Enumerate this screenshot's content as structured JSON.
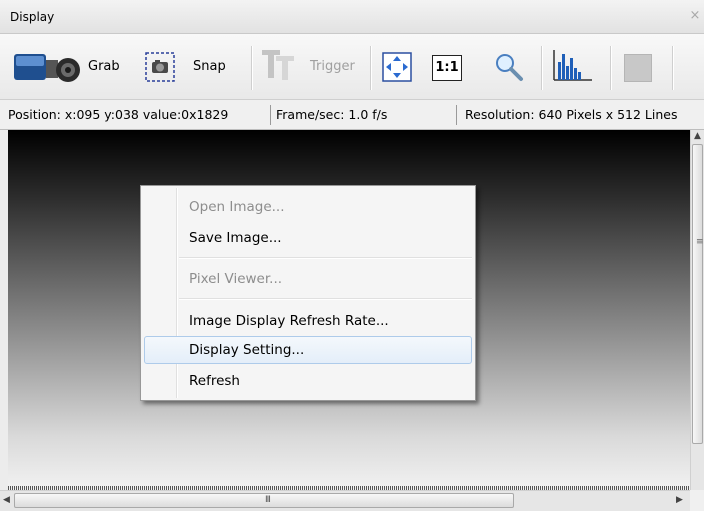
{
  "window": {
    "title": "Display",
    "close_glyph": "×"
  },
  "toolbar": {
    "grab_label": "Grab",
    "snap_label": "Snap",
    "trigger_label": "Trigger",
    "one_to_one_label": "1:1"
  },
  "status": {
    "position": "Position: x:095 y:038 value:0x1829",
    "frame_rate": "Frame/sec: 1.0 f/s",
    "resolution": "Resolution: 640 Pixels x 512 Lines"
  },
  "context_menu": {
    "items": [
      {
        "label": "Open Image...",
        "enabled": false
      },
      {
        "label": "Save Image...",
        "enabled": true
      },
      {
        "label": "Pixel Viewer...",
        "enabled": false
      },
      {
        "label": "Image Display Refresh Rate...",
        "enabled": true
      },
      {
        "label": "Display Setting...",
        "enabled": true,
        "highlighted": true
      },
      {
        "label": "Refresh",
        "enabled": true
      }
    ]
  },
  "scrollbar": {
    "h_grip": "III",
    "v_grip": "≡"
  },
  "colors": {
    "menu_highlight_border": "#aecbea",
    "disabled_text": "#8d8d8d"
  }
}
